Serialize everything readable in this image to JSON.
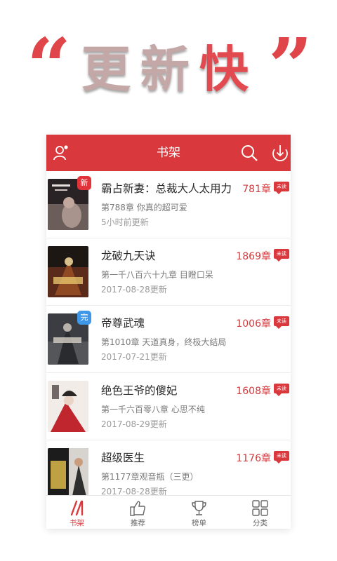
{
  "promo": {
    "quote_open": "“",
    "headline_part1": "更新",
    "headline_part2": "快",
    "quote_close": "”"
  },
  "header": {
    "title": "书架",
    "icons": [
      "user-add-icon",
      "search-icon",
      "download-icon"
    ]
  },
  "books": [
    {
      "title": "霸占新妻：总裁大人太用力",
      "chapters": "781章",
      "unread": "未读",
      "latest": "第788章  你真的超可爱",
      "updated": "5小时前更新",
      "badge": "新"
    },
    {
      "title": "龙破九天诀",
      "chapters": "1869章",
      "unread": "未读",
      "latest": "第一千八百六十九章 目瞪口呆",
      "updated": "2017-08-28更新",
      "badge": ""
    },
    {
      "title": "帝尊武魂",
      "chapters": "1006章",
      "unread": "未读",
      "latest": "第1010章 天道真身，终极大结局",
      "updated": "2017-07-21更新",
      "badge": "完"
    },
    {
      "title": "绝色王爷的傻妃",
      "chapters": "1608章",
      "unread": "未读",
      "latest": "第一千六百零八章 心思不纯",
      "updated": "2017-08-29更新",
      "badge": ""
    },
    {
      "title": "超级医生",
      "chapters": "1176章",
      "unread": "未读",
      "latest": "第1177章观音瓶（三更）",
      "updated": "2017-08-28更新",
      "badge": ""
    }
  ],
  "tabs": [
    {
      "label": "书架",
      "icon": "bookshelf-icon",
      "active": true
    },
    {
      "label": "推荐",
      "icon": "thumbs-up-icon",
      "active": false
    },
    {
      "label": "榜单",
      "icon": "trophy-icon",
      "active": false
    },
    {
      "label": "分类",
      "icon": "grid-icon",
      "active": false
    }
  ],
  "colors": {
    "accent": "#d9393c",
    "promo_text": "#c4a8a8",
    "promo_hot": "#e34a50",
    "complete_badge": "#3f97e8"
  }
}
